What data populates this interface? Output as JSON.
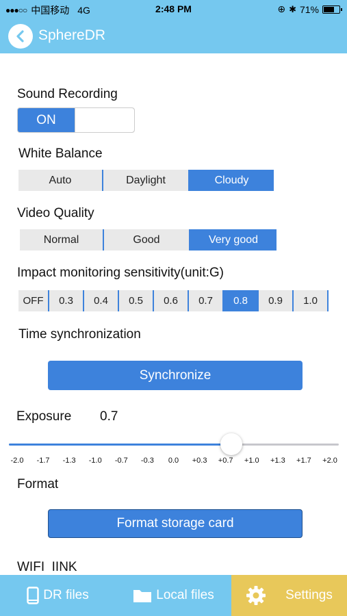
{
  "status": {
    "carrier": "中国移动",
    "network": "4G",
    "time": "2:48 PM",
    "battery": "71%",
    "battery_level": 0.71
  },
  "nav": {
    "title": "SphereDR"
  },
  "sound_recording": {
    "label": "Sound Recording",
    "value": "ON"
  },
  "white_balance": {
    "label": "White Balance",
    "options": [
      "Auto",
      "Daylight",
      "Cloudy"
    ],
    "selected": "Cloudy"
  },
  "video_quality": {
    "label": "Video Quality",
    "options": [
      "Normal",
      "Good",
      "Very good"
    ],
    "selected": "Very good"
  },
  "impact": {
    "label": "Impact monitoring sensitivity(unit:G)",
    "options": [
      "OFF",
      "0.3",
      "0.4",
      "0.5",
      "0.6",
      "0.7",
      "0.8",
      "0.9",
      "1.0"
    ],
    "selected": "0.8"
  },
  "time_sync": {
    "label": "Time synchronization",
    "button": "Synchronize"
  },
  "exposure": {
    "label": "Exposure",
    "value": "0.7",
    "level": 0.675,
    "ticks": [
      "-2.0",
      "-1.7",
      "-1.3",
      "-1.0",
      "-0.7",
      "-0.3",
      "0.0",
      "+0.3",
      "+0.7",
      "+1.0",
      "+1.3",
      "+1.7",
      "+2.0"
    ]
  },
  "format": {
    "label": "Format",
    "button": "Format storage card"
  },
  "wifi": {
    "label": "WIFI  IINK"
  },
  "tabs": [
    {
      "label": "DR files",
      "icon": "phone-icon",
      "selected": false
    },
    {
      "label": "Local files",
      "icon": "folder-icon",
      "selected": false
    },
    {
      "label": "Settings",
      "icon": "gear-icon",
      "selected": true
    }
  ],
  "colors": {
    "header": "#75c8ef",
    "accent": "#3d82dc",
    "selected_tab": "#e8c85a"
  }
}
